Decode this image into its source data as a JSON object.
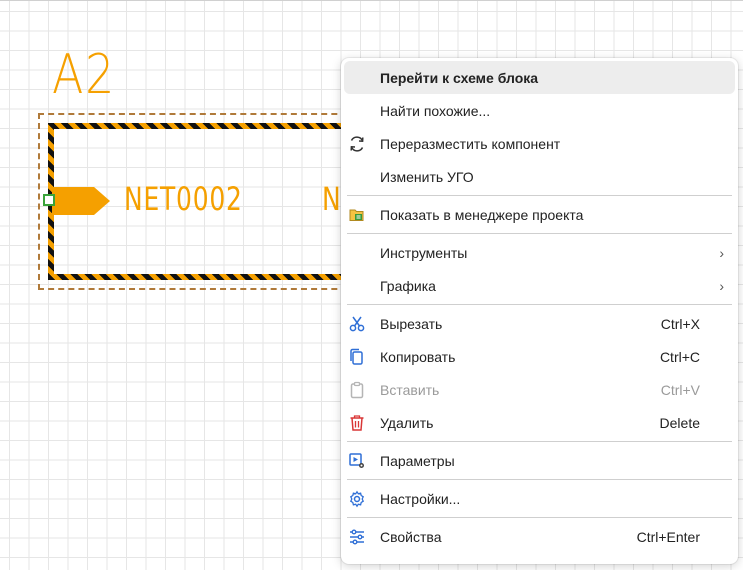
{
  "schematic": {
    "block_label": "A2",
    "net_label": "NET0002",
    "net_label_partial": "N"
  },
  "colors": {
    "accent": "#f5a000",
    "stripe_dark": "#111111",
    "pin": "#39a33a",
    "menu_icon": "#2f6fd6",
    "delete_icon": "#d93636"
  },
  "context_menu": {
    "go_to_block_schematic": "Перейти к схеме блока",
    "find_similar": "Найти похожие...",
    "rearrange_component": "Переразместить компонент",
    "change_ugo": "Изменить УГО",
    "show_in_project_manager": "Показать в менеджере проекта",
    "tools": "Инструменты",
    "graphics": "Графика",
    "cut": "Вырезать",
    "cut_shortcut": "Ctrl+X",
    "copy": "Копировать",
    "copy_shortcut": "Ctrl+C",
    "paste": "Вставить",
    "paste_shortcut": "Ctrl+V",
    "delete": "Удалить",
    "delete_shortcut": "Delete",
    "parameters": "Параметры",
    "settings": "Настройки...",
    "properties": "Свойства",
    "properties_shortcut": "Ctrl+Enter",
    "submenu_arrow": "›"
  }
}
